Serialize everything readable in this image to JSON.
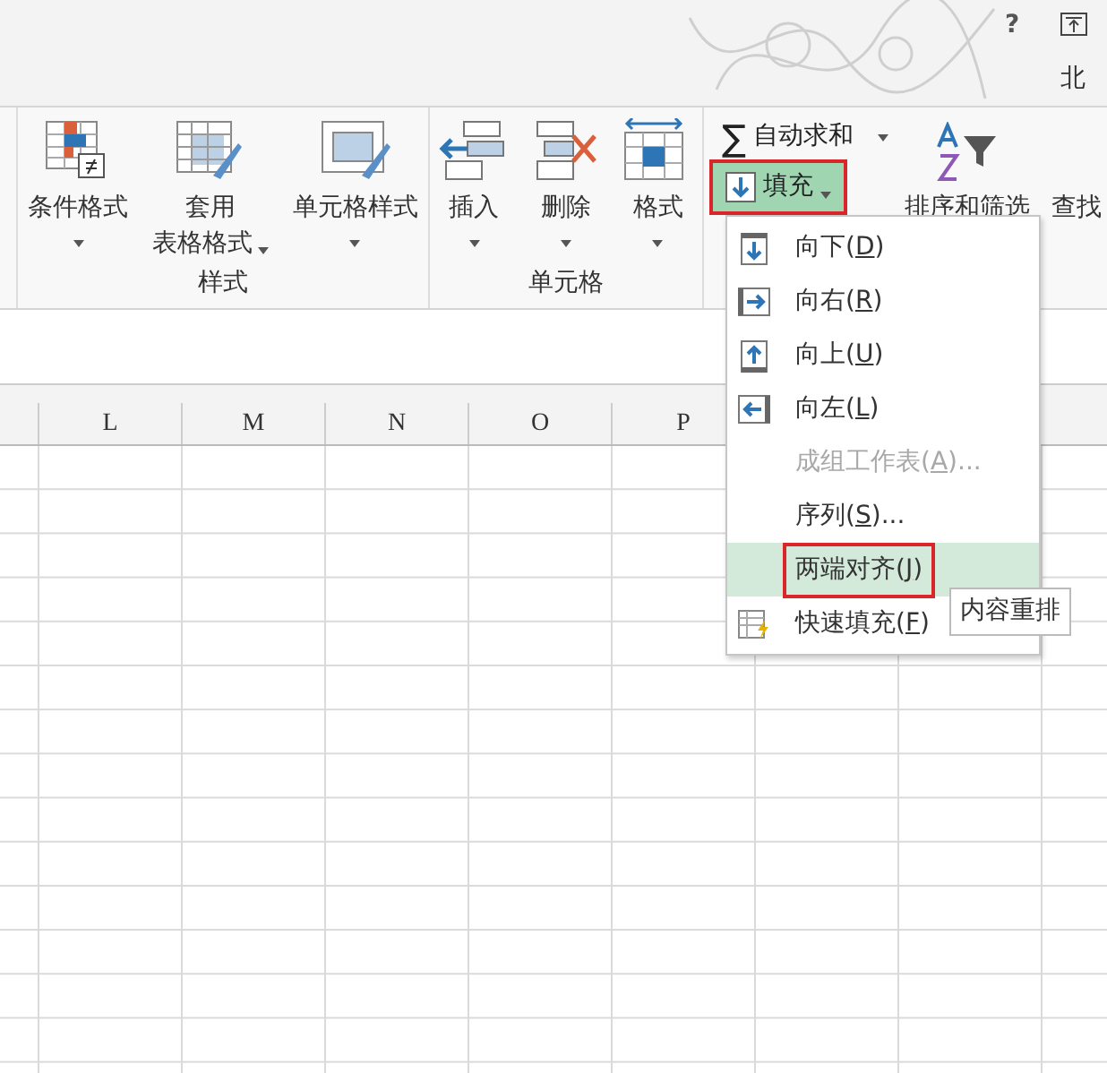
{
  "title_bar": {
    "help": "?",
    "user": "北"
  },
  "ribbon": {
    "groups": [
      {
        "label": "样式",
        "buttons": [
          {
            "kind": "conditional",
            "lines": [
              "条件格式"
            ],
            "dropdown": true
          },
          {
            "kind": "table",
            "lines": [
              "套用",
              "表格格式"
            ],
            "dropdown": true
          },
          {
            "kind": "cellstyle",
            "lines": [
              "单元格样式"
            ],
            "dropdown": true
          }
        ]
      },
      {
        "label": "单元格",
        "buttons": [
          {
            "kind": "insert",
            "lines": [
              "插入"
            ],
            "dropdown": true
          },
          {
            "kind": "delete",
            "lines": [
              "删除"
            ],
            "dropdown": true
          },
          {
            "kind": "format",
            "lines": [
              "格式"
            ],
            "dropdown": true
          }
        ]
      }
    ],
    "editing": {
      "autosum": {
        "symbol": "∑",
        "label": "自动求和"
      },
      "fill": {
        "label": "填充",
        "selected": true,
        "annotated": true
      },
      "sort": {
        "label": "排序和筛选"
      },
      "find": {
        "label": "查找"
      }
    }
  },
  "sheet": {
    "columns": [
      "L",
      "M",
      "N",
      "O",
      "P"
    ]
  },
  "fill_menu": {
    "items": [
      {
        "kind": "down",
        "before": "向下(",
        "key": "D",
        "after": ")",
        "disabled": false,
        "selected": false,
        "annotated": false
      },
      {
        "kind": "right",
        "before": "向右(",
        "key": "R",
        "after": ")",
        "disabled": false,
        "selected": false,
        "annotated": false
      },
      {
        "kind": "up",
        "before": "向上(",
        "key": "U",
        "after": ")",
        "disabled": false,
        "selected": false,
        "annotated": false
      },
      {
        "kind": "left",
        "before": "向左(",
        "key": "L",
        "after": ")",
        "disabled": false,
        "selected": false,
        "annotated": false
      },
      {
        "kind": "plain",
        "before": "成组工作表(",
        "key": "A",
        "after": ")...",
        "disabled": true,
        "selected": false,
        "annotated": false
      },
      {
        "kind": "plain",
        "before": "序列(",
        "key": "S",
        "after": ")...",
        "disabled": false,
        "selected": false,
        "annotated": false
      },
      {
        "kind": "plain",
        "before": "两端对齐(",
        "key": "J",
        "after": ")",
        "disabled": false,
        "selected": true,
        "annotated": true
      },
      {
        "kind": "flash",
        "before": "快速填充(",
        "key": "F",
        "after": ")",
        "disabled": false,
        "selected": false,
        "annotated": false
      }
    ],
    "tooltip": "内容重排"
  }
}
